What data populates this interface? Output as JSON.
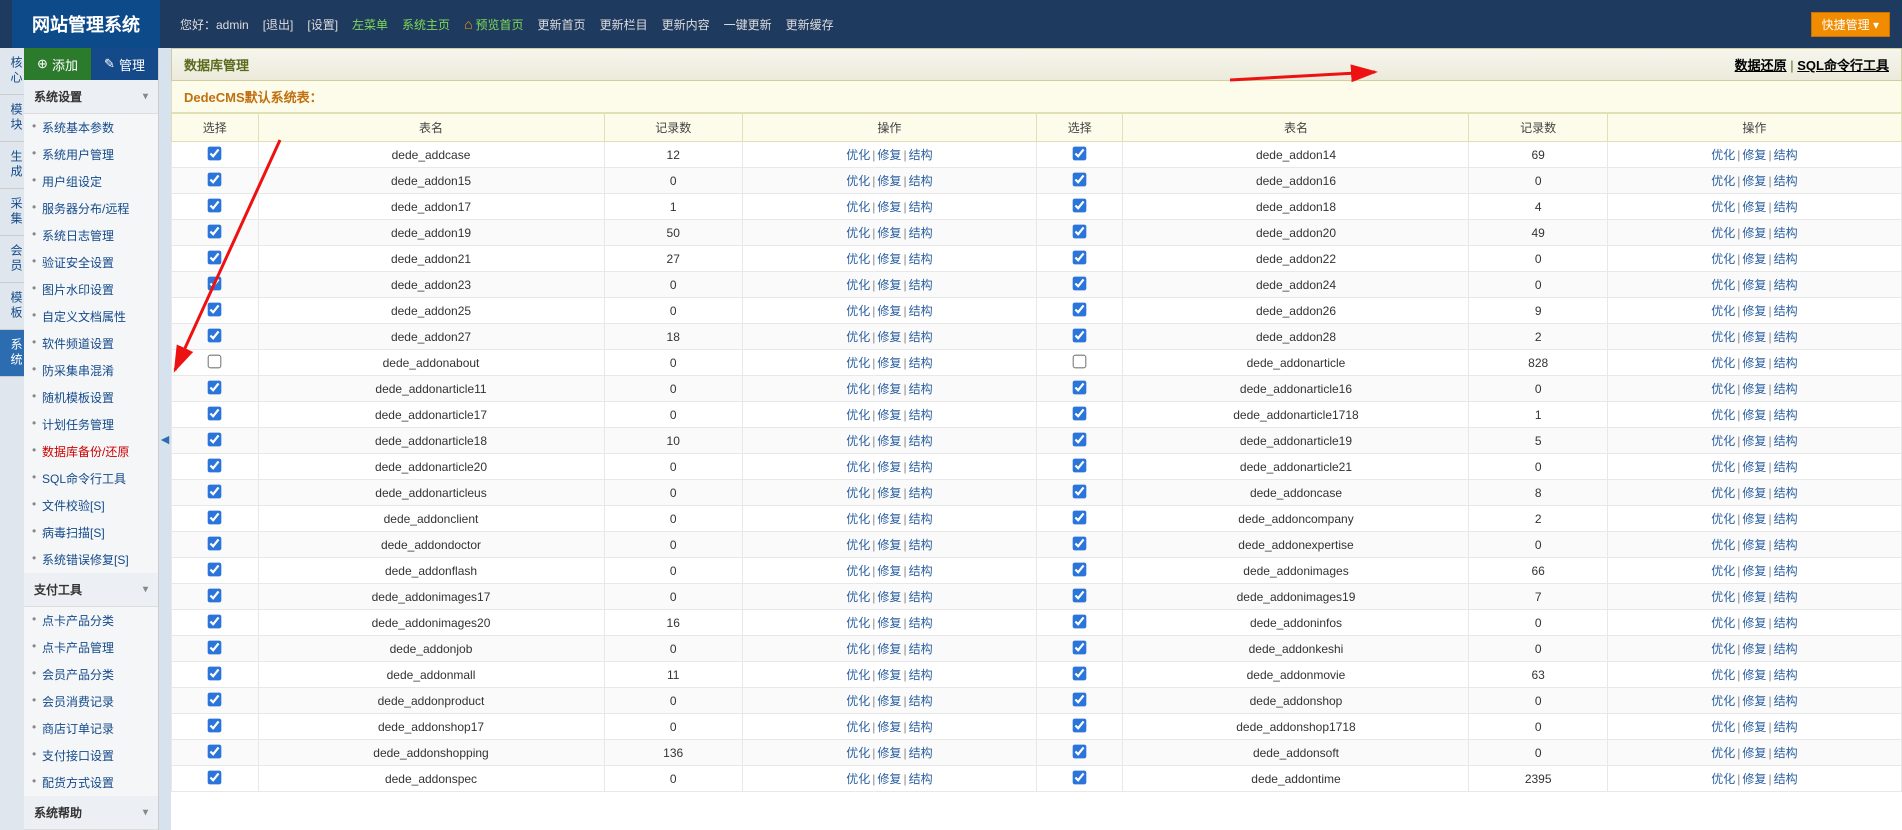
{
  "header": {
    "logo": "网站管理系统",
    "greeting": "您好：admin",
    "logout": "[退出]",
    "settings": "[设置]",
    "left_menu": "左菜单",
    "sys_home": "系统主页",
    "preview_home": "预览首页",
    "update_home": "更新首页",
    "update_column": "更新栏目",
    "update_content": "更新内容",
    "one_click": "一键更新",
    "update_cache": "更新缓存",
    "quick_manage": "快捷管理 ▾"
  },
  "side_tabs": [
    "核心",
    "模块",
    "生成",
    "采集",
    "会员",
    "模板",
    "系统"
  ],
  "side_tabs_active_index": 6,
  "buttons": {
    "add": "添加",
    "manage": "管理",
    "add_icon": "⊕",
    "manage_icon": "✎"
  },
  "sidebar_sections": [
    {
      "title": "系统设置",
      "items": [
        {
          "label": "系统基本参数"
        },
        {
          "label": "系统用户管理"
        },
        {
          "label": "用户组设定"
        },
        {
          "label": "服务器分布/远程"
        },
        {
          "label": "系统日志管理"
        },
        {
          "label": "验证安全设置"
        },
        {
          "label": "图片水印设置"
        },
        {
          "label": "自定义文档属性"
        },
        {
          "label": "软件频道设置"
        },
        {
          "label": "防采集串混淆"
        },
        {
          "label": "随机模板设置"
        },
        {
          "label": "计划任务管理"
        },
        {
          "label": "数据库备份/还原",
          "highlight": true
        },
        {
          "label": "SQL命令行工具"
        },
        {
          "label": "文件校验[S]"
        },
        {
          "label": "病毒扫描[S]"
        },
        {
          "label": "系统错误修复[S]"
        }
      ]
    },
    {
      "title": "支付工具",
      "items": [
        {
          "label": "点卡产品分类"
        },
        {
          "label": "点卡产品管理"
        },
        {
          "label": "会员产品分类"
        },
        {
          "label": "会员消费记录"
        },
        {
          "label": "商店订单记录"
        },
        {
          "label": "支付接口设置"
        },
        {
          "label": "配货方式设置"
        }
      ]
    },
    {
      "title": "系统帮助",
      "items": []
    }
  ],
  "main_header": {
    "title": "数据库管理",
    "link_restore": "数据还原",
    "link_sql": "SQL命令行工具",
    "sep": " | "
  },
  "sub_title": "DedeCMS默认系统表：",
  "table_headers": {
    "select": "选择",
    "name": "表名",
    "records": "记录数",
    "ops": "操作"
  },
  "op_labels": {
    "opt": "优化",
    "repair": "修复",
    "struct": "结构"
  },
  "rows": [
    {
      "l": {
        "chk": true,
        "name": "dede_addcase",
        "rec": 12
      },
      "r": {
        "chk": true,
        "name": "dede_addon14",
        "rec": 69
      }
    },
    {
      "l": {
        "chk": true,
        "name": "dede_addon15",
        "rec": 0
      },
      "r": {
        "chk": true,
        "name": "dede_addon16",
        "rec": 0
      }
    },
    {
      "l": {
        "chk": true,
        "name": "dede_addon17",
        "rec": 1
      },
      "r": {
        "chk": true,
        "name": "dede_addon18",
        "rec": 4
      }
    },
    {
      "l": {
        "chk": true,
        "name": "dede_addon19",
        "rec": 50
      },
      "r": {
        "chk": true,
        "name": "dede_addon20",
        "rec": 49
      }
    },
    {
      "l": {
        "chk": true,
        "name": "dede_addon21",
        "rec": 27
      },
      "r": {
        "chk": true,
        "name": "dede_addon22",
        "rec": 0
      }
    },
    {
      "l": {
        "chk": true,
        "name": "dede_addon23",
        "rec": 0
      },
      "r": {
        "chk": true,
        "name": "dede_addon24",
        "rec": 0
      }
    },
    {
      "l": {
        "chk": true,
        "name": "dede_addon25",
        "rec": 0
      },
      "r": {
        "chk": true,
        "name": "dede_addon26",
        "rec": 9
      }
    },
    {
      "l": {
        "chk": true,
        "name": "dede_addon27",
        "rec": 18
      },
      "r": {
        "chk": true,
        "name": "dede_addon28",
        "rec": 2
      }
    },
    {
      "l": {
        "chk": false,
        "name": "dede_addonabout",
        "rec": 0
      },
      "r": {
        "chk": false,
        "name": "dede_addonarticle",
        "rec": 828
      }
    },
    {
      "l": {
        "chk": true,
        "name": "dede_addonarticle11",
        "rec": 0
      },
      "r": {
        "chk": true,
        "name": "dede_addonarticle16",
        "rec": 0
      }
    },
    {
      "l": {
        "chk": true,
        "name": "dede_addonarticle17",
        "rec": 0
      },
      "r": {
        "chk": true,
        "name": "dede_addonarticle1718",
        "rec": 1
      }
    },
    {
      "l": {
        "chk": true,
        "name": "dede_addonarticle18",
        "rec": 10
      },
      "r": {
        "chk": true,
        "name": "dede_addonarticle19",
        "rec": 5
      }
    },
    {
      "l": {
        "chk": true,
        "name": "dede_addonarticle20",
        "rec": 0
      },
      "r": {
        "chk": true,
        "name": "dede_addonarticle21",
        "rec": 0
      }
    },
    {
      "l": {
        "chk": true,
        "name": "dede_addonarticleus",
        "rec": 0
      },
      "r": {
        "chk": true,
        "name": "dede_addoncase",
        "rec": 8
      }
    },
    {
      "l": {
        "chk": true,
        "name": "dede_addonclient",
        "rec": 0
      },
      "r": {
        "chk": true,
        "name": "dede_addoncompany",
        "rec": 2
      }
    },
    {
      "l": {
        "chk": true,
        "name": "dede_addondoctor",
        "rec": 0
      },
      "r": {
        "chk": true,
        "name": "dede_addonexpertise",
        "rec": 0
      }
    },
    {
      "l": {
        "chk": true,
        "name": "dede_addonflash",
        "rec": 0
      },
      "r": {
        "chk": true,
        "name": "dede_addonimages",
        "rec": 66
      }
    },
    {
      "l": {
        "chk": true,
        "name": "dede_addonimages17",
        "rec": 0
      },
      "r": {
        "chk": true,
        "name": "dede_addonimages19",
        "rec": 7
      }
    },
    {
      "l": {
        "chk": true,
        "name": "dede_addonimages20",
        "rec": 16
      },
      "r": {
        "chk": true,
        "name": "dede_addoninfos",
        "rec": 0
      }
    },
    {
      "l": {
        "chk": true,
        "name": "dede_addonjob",
        "rec": 0
      },
      "r": {
        "chk": true,
        "name": "dede_addonkeshi",
        "rec": 0
      }
    },
    {
      "l": {
        "chk": true,
        "name": "dede_addonmall",
        "rec": 11
      },
      "r": {
        "chk": true,
        "name": "dede_addonmovie",
        "rec": 63
      }
    },
    {
      "l": {
        "chk": true,
        "name": "dede_addonproduct",
        "rec": 0
      },
      "r": {
        "chk": true,
        "name": "dede_addonshop",
        "rec": 0
      }
    },
    {
      "l": {
        "chk": true,
        "name": "dede_addonshop17",
        "rec": 0
      },
      "r": {
        "chk": true,
        "name": "dede_addonshop1718",
        "rec": 0
      }
    },
    {
      "l": {
        "chk": true,
        "name": "dede_addonshopping",
        "rec": 136
      },
      "r": {
        "chk": true,
        "name": "dede_addonsoft",
        "rec": 0
      }
    },
    {
      "l": {
        "chk": true,
        "name": "dede_addonspec",
        "rec": 0
      },
      "r": {
        "chk": true,
        "name": "dede_addontime",
        "rec": 2395
      }
    }
  ]
}
